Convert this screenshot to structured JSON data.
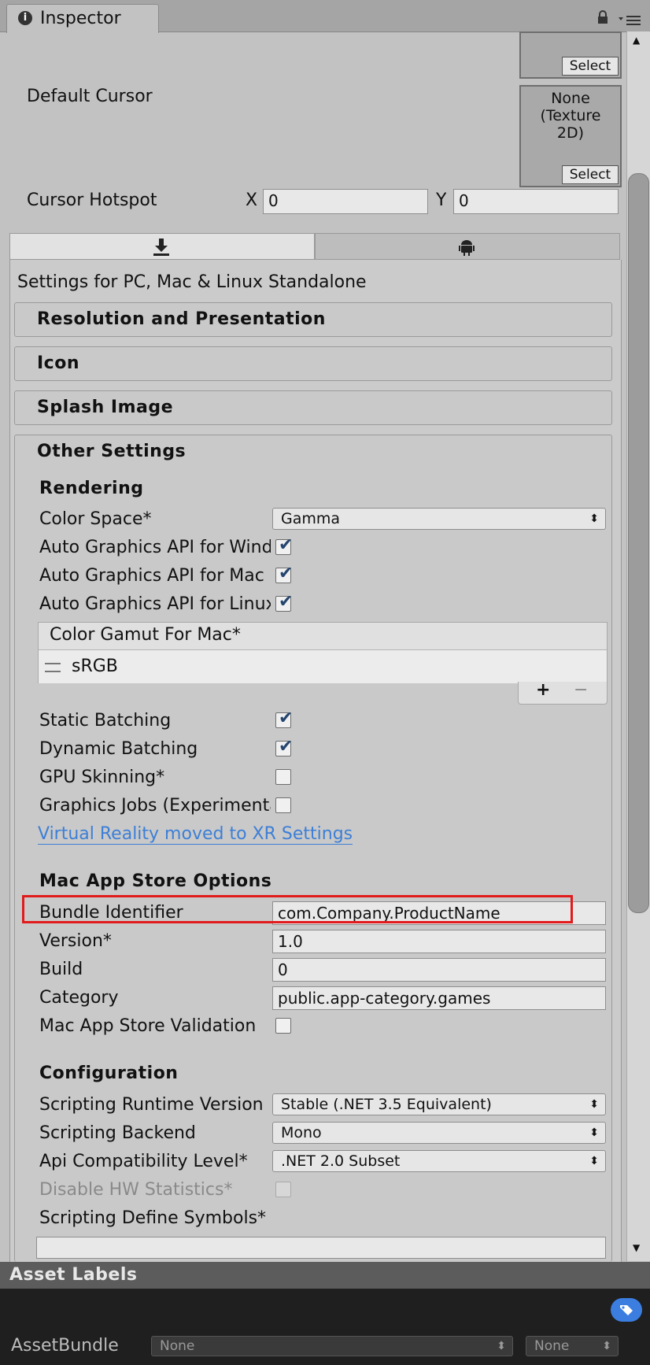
{
  "window": {
    "tab_title": "Inspector"
  },
  "cursor": {
    "select_label": "Select",
    "default_cursor_label": "Default Cursor",
    "default_cursor_value": "None\n(Texture\n2D)",
    "hotspot_label": "Cursor Hotspot",
    "hotspot_x_label": "X",
    "hotspot_x": "0",
    "hotspot_y_label": "Y",
    "hotspot_y": "0"
  },
  "platform": {
    "settings_for": "Settings for PC, Mac & Linux Standalone"
  },
  "sections": {
    "resolution": "Resolution and Presentation",
    "icon": "Icon",
    "splash": "Splash Image",
    "other": "Other Settings"
  },
  "rendering": {
    "heading": "Rendering",
    "color_space_label": "Color Space*",
    "color_space_value": "Gamma",
    "auto_win": "Auto Graphics API for Windows",
    "auto_mac": "Auto Graphics API for Mac",
    "auto_linux": "Auto Graphics API for Linux",
    "gamut_header": "Color Gamut For Mac*",
    "gamut_item": "sRGB",
    "add": "+",
    "remove": "−",
    "static_batching": "Static Batching",
    "dynamic_batching": "Dynamic Batching",
    "gpu_skinning": "GPU Skinning*",
    "graphics_jobs": "Graphics Jobs (Experimental)",
    "vr_link": "Virtual Reality moved to XR Settings"
  },
  "mac_store": {
    "heading": "Mac App Store Options",
    "bundle_label": "Bundle Identifier",
    "bundle_value": "com.Company.ProductName",
    "version_label": "Version*",
    "version_value": "1.0",
    "build_label": "Build",
    "build_value": "0",
    "category_label": "Category",
    "category_value": "public.app-category.games",
    "validation_label": "Mac App Store Validation"
  },
  "configuration": {
    "heading": "Configuration",
    "runtime_label": "Scripting Runtime Version",
    "runtime_value": "Stable (.NET 3.5 Equivalent)",
    "backend_label": "Scripting Backend",
    "backend_value": "Mono",
    "api_label": "Api Compatibility Level*",
    "api_value": ".NET 2.0 Subset",
    "hwstats_label": "Disable HW Statistics*",
    "define_label": "Scripting Define Symbols*",
    "define_value": ""
  },
  "asset_labels": {
    "heading": "Asset Labels",
    "assetbundle_label": "AssetBundle",
    "bundle_name": "None",
    "bundle_variant": "None"
  },
  "colors": {
    "highlight": "#e11b1b",
    "link": "#3d7fd6",
    "tag_icon": "#3b7ee0"
  }
}
